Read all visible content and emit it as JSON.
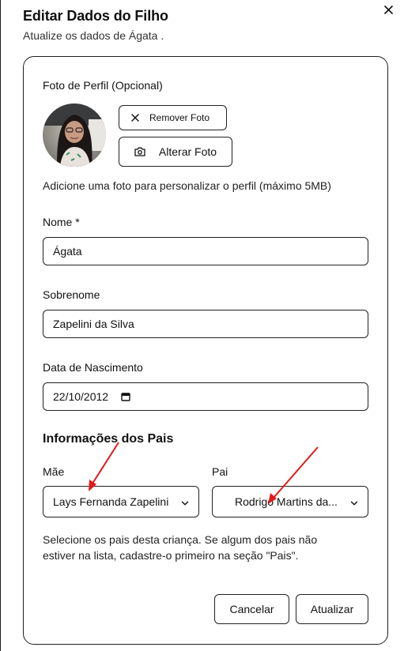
{
  "dialog": {
    "title": "Editar Dados do Filho",
    "subtitle": "Atualize os dados de Ágata ."
  },
  "photo": {
    "label": "Foto de Perfil (Opcional)",
    "remove_label": "Remover Foto",
    "change_label": "Alterar Foto",
    "hint": "Adicione uma foto para personalizar o perfil (máximo 5MB)"
  },
  "fields": {
    "first_name_label": "Nome *",
    "first_name_value": "Ágata",
    "last_name_label": "Sobrenome",
    "last_name_value": "Zapelini da Silva",
    "birth_label": "Data de Nascimento",
    "birth_value": "22/10/2012"
  },
  "parents": {
    "heading": "Informações dos Pais",
    "mother_label": "Mãe",
    "mother_value": "Lays Fernanda Zapelini",
    "father_label": "Pai",
    "father_value": "Rodrigo Martins da...",
    "hint": "Selecione os pais desta criança. Se algum dos pais não estiver na lista, cadastre-o primeiro na seção \"Pais\"."
  },
  "actions": {
    "cancel_label": "Cancelar",
    "submit_label": "Atualizar"
  },
  "colors": {
    "annotation_arrow": "#e3191b",
    "border": "#1f1f1f"
  },
  "icons": [
    "close-icon",
    "x-icon",
    "camera-icon",
    "calendar-icon",
    "chevron-down-icon"
  ]
}
